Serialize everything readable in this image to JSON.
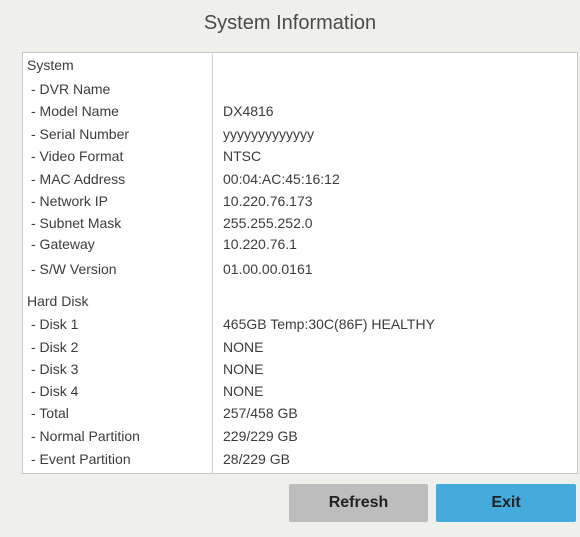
{
  "window": {
    "title": "System Information"
  },
  "system": {
    "heading": "System",
    "rows": [
      {
        "label": " - DVR Name",
        "value": ""
      },
      {
        "label": " - Model Name",
        "value": "DX4816"
      },
      {
        "label": " - Serial Number",
        "value": "yyyyyyyyyyyyy"
      },
      {
        "label": " - Video Format",
        "value": "NTSC"
      },
      {
        "label": " - MAC Address",
        "value": "00:04:AC:45:16:12"
      },
      {
        "label": " - Network IP",
        "value": "10.220.76.173"
      },
      {
        "label": " - Subnet Mask",
        "value": "255.255.252.0"
      },
      {
        "label": " - Gateway",
        "value": "10.220.76.1"
      },
      {
        "label": " - S/W Version",
        "value": "01.00.00.0161"
      }
    ]
  },
  "hard_disk": {
    "heading": "Hard Disk",
    "rows": [
      {
        "label": " - Disk 1",
        "value": "465GB Temp:30C(86F) HEALTHY"
      },
      {
        "label": " - Disk 2",
        "value": "NONE"
      },
      {
        "label": " - Disk 3",
        "value": "NONE"
      },
      {
        "label": " - Disk 4",
        "value": "NONE"
      },
      {
        "label": " - Total",
        "value": "257/458 GB"
      },
      {
        "label": " - Normal Partition",
        "value": "229/229 GB"
      },
      {
        "label": " - Event Partition",
        "value": "28/229 GB"
      }
    ]
  },
  "buttons": {
    "refresh_label": "Refresh",
    "exit_label": "Exit"
  },
  "colors": {
    "background": "#efefec",
    "panel": "#ffffff",
    "refresh_button": "#bdbdbd",
    "exit_button": "#45abdc"
  }
}
